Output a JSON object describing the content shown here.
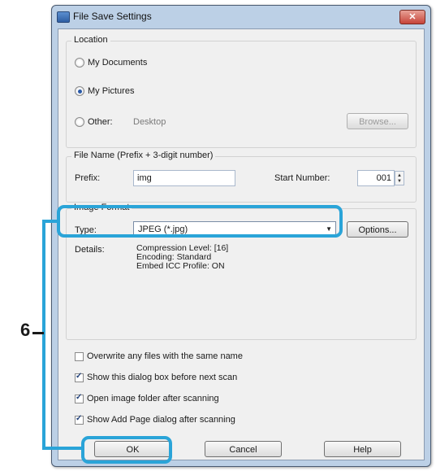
{
  "window": {
    "title": "File Save Settings",
    "close_glyph": "✕"
  },
  "location": {
    "group_title": "Location",
    "options": [
      {
        "label": "My Documents",
        "selected": false
      },
      {
        "label": "My Pictures",
        "selected": true
      },
      {
        "label": "Other:",
        "selected": false
      }
    ],
    "other_path": "Desktop",
    "browse_label": "Browse..."
  },
  "file_name": {
    "group_title": "File Name (Prefix + 3-digit number)",
    "prefix_label": "Prefix:",
    "prefix_value": "img",
    "start_number_label": "Start Number:",
    "start_number_value": "001"
  },
  "image_format": {
    "group_title": "Image Format",
    "type_label": "Type:",
    "type_value": "JPEG (*.jpg)",
    "options_label": "Options...",
    "details_label": "Details:",
    "details_lines": [
      "Compression Level: [16]",
      "Encoding: Standard",
      "Embed ICC Profile: ON"
    ]
  },
  "checkboxes": [
    {
      "label": "Overwrite any files with the same name",
      "checked": false
    },
    {
      "label": "Show this dialog box before next scan",
      "checked": true
    },
    {
      "label": "Open image folder after scanning",
      "checked": true
    },
    {
      "label": "Show Add Page dialog after scanning",
      "checked": true
    }
  ],
  "buttons": {
    "ok": "OK",
    "cancel": "Cancel",
    "help": "Help"
  },
  "annotation": {
    "step_number": "6",
    "highlight_color": "#2aa4d8"
  }
}
